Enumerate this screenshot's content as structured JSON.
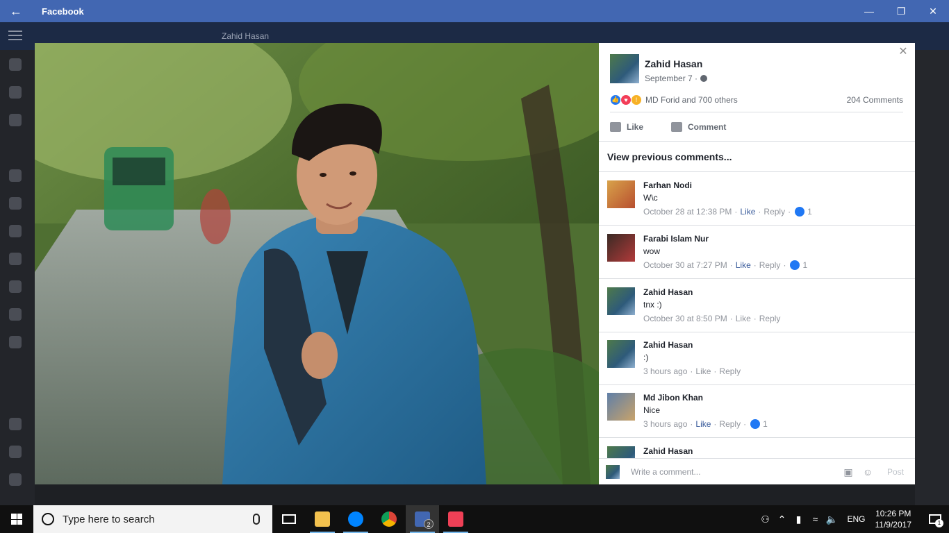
{
  "window": {
    "title": "Facebook",
    "back_icon": "arrow-left-icon",
    "minimize_icon": "minimize-icon",
    "restore_icon": "restore-icon",
    "close_icon": "close-icon"
  },
  "background": {
    "search_text": "Zahid Hasan"
  },
  "post": {
    "author": "Zahid Hasan",
    "date": "September 7 ·",
    "reactors": "MD Forid and 700 others",
    "comments_count": "204 Comments",
    "like_label": "Like",
    "comment_label": "Comment",
    "view_previous": "View previous comments..."
  },
  "comments": [
    {
      "name": "Farhan Nodi",
      "text": "W\\c",
      "time": "October 28 at 12:38 PM",
      "like": "Like",
      "reply": "Reply",
      "likes": "1",
      "liked_style": true
    },
    {
      "name": "Farabi Islam Nur",
      "text": "wow",
      "time": "October 30 at 7:27 PM",
      "like": "Like",
      "reply": "Reply",
      "likes": "1",
      "liked_style": true
    },
    {
      "name": "Zahid Hasan",
      "text": "tnx :)",
      "time": "October 30 at 8:50 PM",
      "like": "Like",
      "reply": "Reply",
      "likes": "",
      "liked_style": false
    },
    {
      "name": "Zahid Hasan",
      "text": ":)",
      "time": "3 hours ago",
      "like": "Like",
      "reply": "Reply",
      "likes": "",
      "liked_style": false
    },
    {
      "name": "Md Jibon Khan",
      "text": "Nice",
      "time": "3 hours ago",
      "like": "Like",
      "reply": "Reply",
      "likes": "1",
      "liked_style": true
    },
    {
      "name": "Zahid Hasan",
      "text": "",
      "time": "",
      "like": "",
      "reply": "",
      "likes": "",
      "liked_style": false
    }
  ],
  "composer": {
    "placeholder": "Write a comment...",
    "post_label": "Post"
  },
  "taskbar": {
    "search_placeholder": "Type here to search",
    "facebook_badge": "2",
    "language": "ENG",
    "time": "10:26 PM",
    "date": "11/9/2017",
    "notification_count": "1"
  },
  "colors": {
    "facebook_blue": "#4267b2",
    "link_blue": "#365899",
    "like_blue": "#2078f4"
  }
}
